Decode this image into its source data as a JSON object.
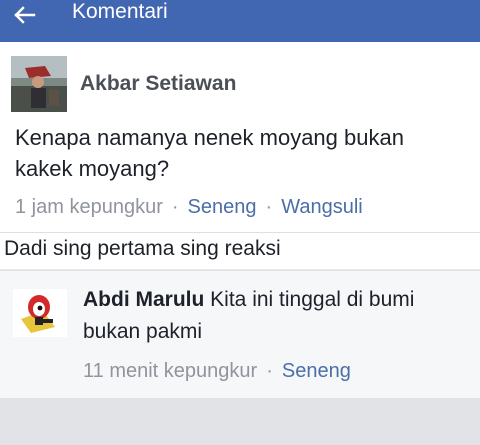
{
  "header": {
    "title": "Komentari",
    "back_icon": "arrow-left-icon",
    "color": "#4267b2"
  },
  "post": {
    "author": "Akbar Setiawan",
    "text": "Kenapa namanya nenek moyang bukan kakek moyang?",
    "time": "1 jam kepungkur",
    "like_label": "Seneng",
    "reply_label": "Wangsuli"
  },
  "first_reaction": "Dadi sing pertama sing reaksi",
  "comment": {
    "author": "Abdi Marulu",
    "text": "Kita ini tinggal di bumi bukan pakmi",
    "time": "11 menit kepungkur",
    "like_label": "Seneng"
  },
  "colors": {
    "link": "#4b6ea8",
    "meta": "#90949c"
  }
}
